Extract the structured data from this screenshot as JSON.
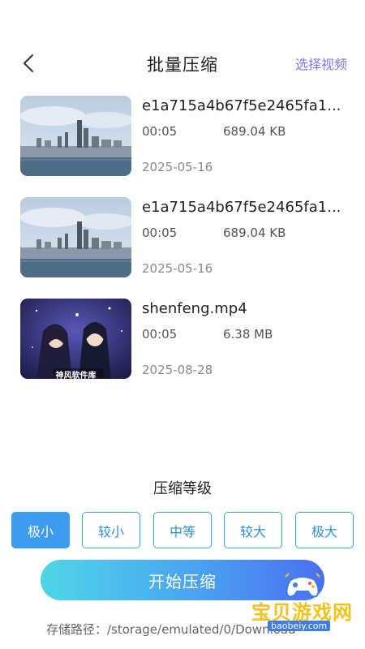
{
  "header": {
    "title": "批量压缩",
    "select_video": "选择视频",
    "back_icon": "chevron-left-icon"
  },
  "videos": [
    {
      "name": "e1a715a4b67f5e2465fa1...",
      "duration": "00:05",
      "size": "689.04 KB",
      "date": "2025-05-16",
      "thumbnail": "city-harbor-skyline"
    },
    {
      "name": "e1a715a4b67f5e2465fa1...",
      "duration": "00:05",
      "size": "689.04 KB",
      "date": "2025-05-16",
      "thumbnail": "city-harbor-skyline"
    },
    {
      "name": "shenfeng.mp4",
      "duration": "00:05",
      "size": "6.38 MB",
      "date": "2025-08-28",
      "thumbnail": "anime-couple",
      "thumbnail_caption": "神风软件库"
    }
  ],
  "compression": {
    "title": "压缩等级",
    "levels": [
      "极小",
      "较小",
      "中等",
      "较大",
      "极大"
    ],
    "selected_index": 0
  },
  "start_button": "开始压缩",
  "storage_path": "存储路径：/storage/emulated/0/Download",
  "watermark": {
    "text": "宝贝游戏网",
    "url": "baobeiy.com"
  },
  "colors": {
    "accent_purple": "#7b78e6",
    "level_blue": "#3d9bf0",
    "gradient_start": "#4fd6e6",
    "gradient_end": "#4a6ff2"
  }
}
